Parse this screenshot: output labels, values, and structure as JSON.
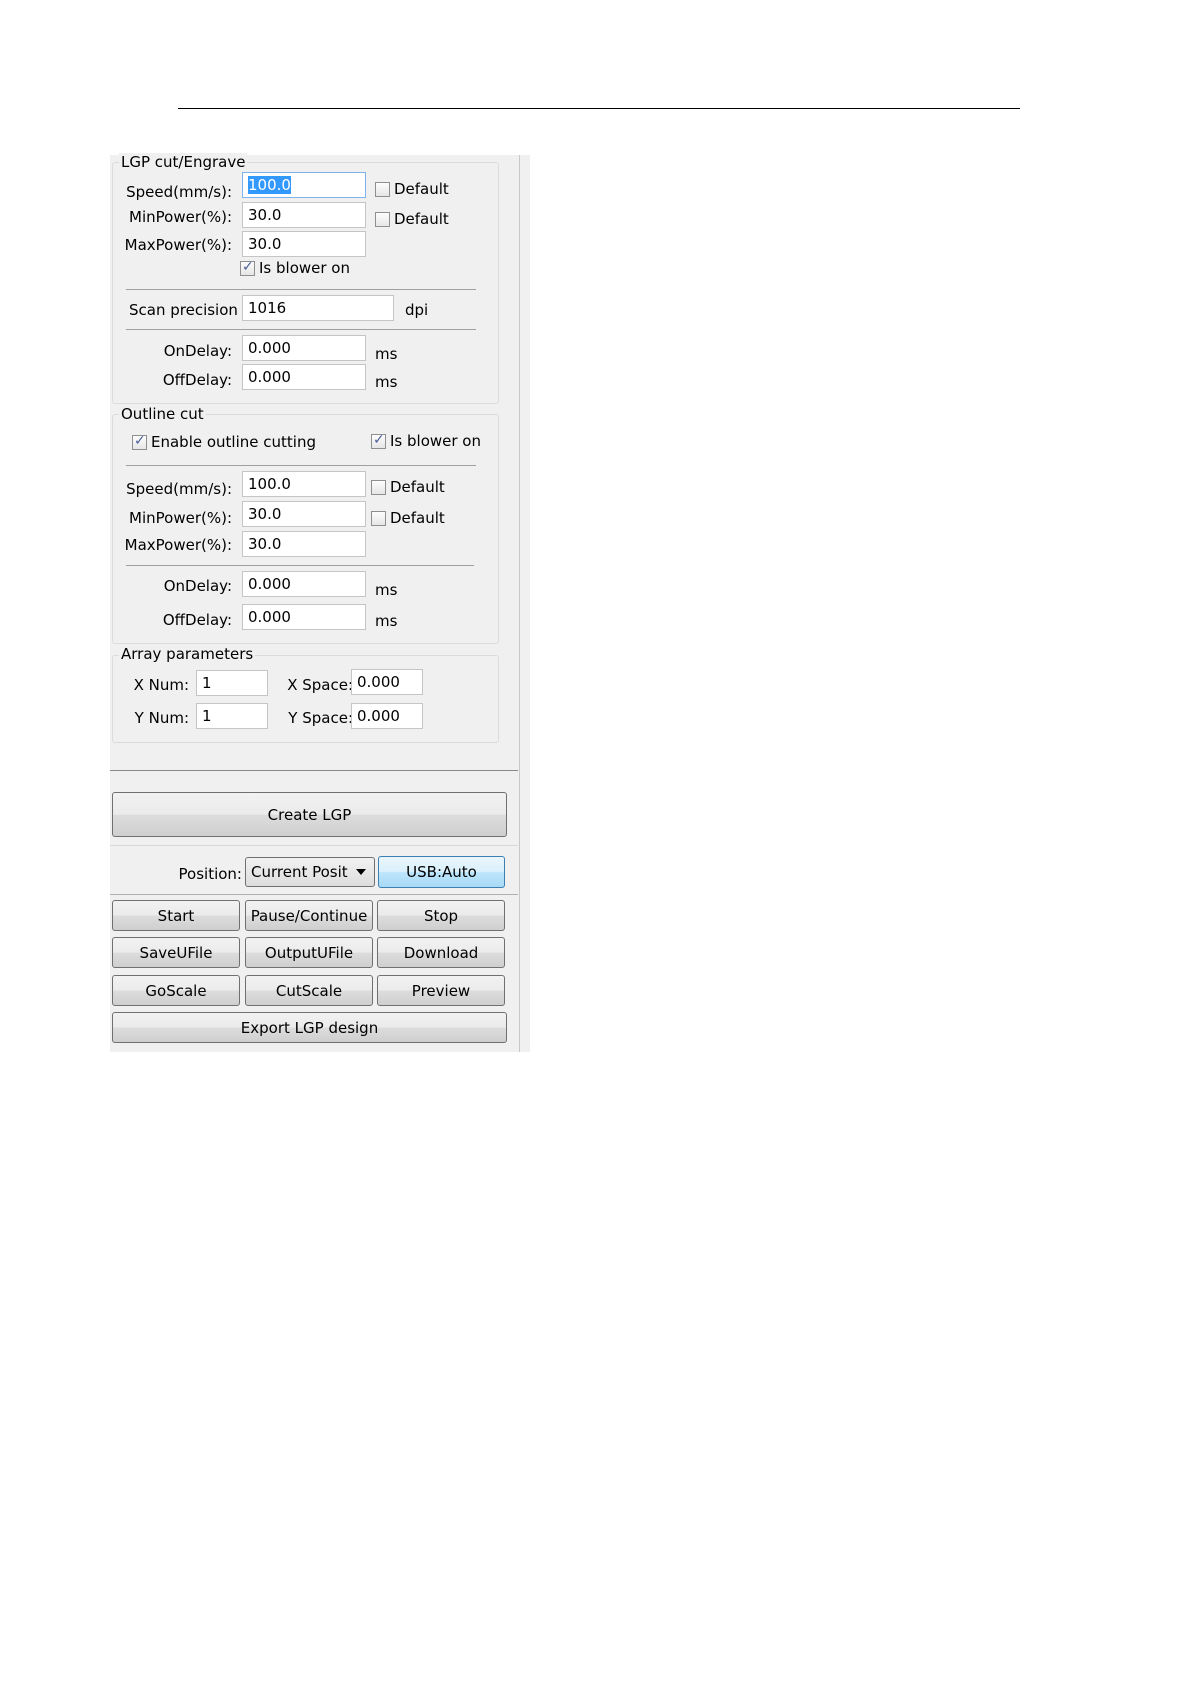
{
  "lgp": {
    "title": "LGP cut/Engrave",
    "speed_label": "Speed(mm/s):",
    "speed": "100.0",
    "minpower_label": "MinPower(%):",
    "minpower": "30.0",
    "maxpower_label": "MaxPower(%):",
    "maxpower": "30.0",
    "default_label": "Default",
    "blower_label": "Is blower on",
    "scan_label": "Scan precision",
    "scan": "1016",
    "scan_unit": "dpi",
    "ondelay_label": "OnDelay:",
    "ondelay": "0.000",
    "offdelay_label": "OffDelay:",
    "offdelay": "0.000",
    "ms": "ms"
  },
  "outline": {
    "title": "Outline cut",
    "enable_label": "Enable outline cutting",
    "blower_label": "Is blower on",
    "speed_label": "Speed(mm/s):",
    "speed": "100.0",
    "minpower_label": "MinPower(%):",
    "minpower": "30.0",
    "maxpower_label": "MaxPower(%):",
    "maxpower": "30.0",
    "default_label": "Default",
    "ondelay_label": "OnDelay:",
    "ondelay": "0.000",
    "offdelay_label": "OffDelay:",
    "offdelay": "0.000",
    "ms": "ms"
  },
  "array": {
    "title": "Array parameters",
    "xnum_label": "X Num:",
    "xnum": "1",
    "ynum_label": "Y Num:",
    "ynum": "1",
    "xspace_label": "X Space:",
    "xspace": "0.000",
    "yspace_label": "Y Space:",
    "yspace": "0.000"
  },
  "controls": {
    "create": "Create LGP",
    "position_label": "Position:",
    "position_value": "Current Posit",
    "usb": "USB:Auto",
    "start": "Start",
    "pause": "Pause/Continue",
    "stop": "Stop",
    "saveufile": "SaveUFile",
    "outputufile": "OutputUFile",
    "download": "Download",
    "goscale": "GoScale",
    "cutscale": "CutScale",
    "preview": "Preview",
    "export": "Export LGP design"
  }
}
